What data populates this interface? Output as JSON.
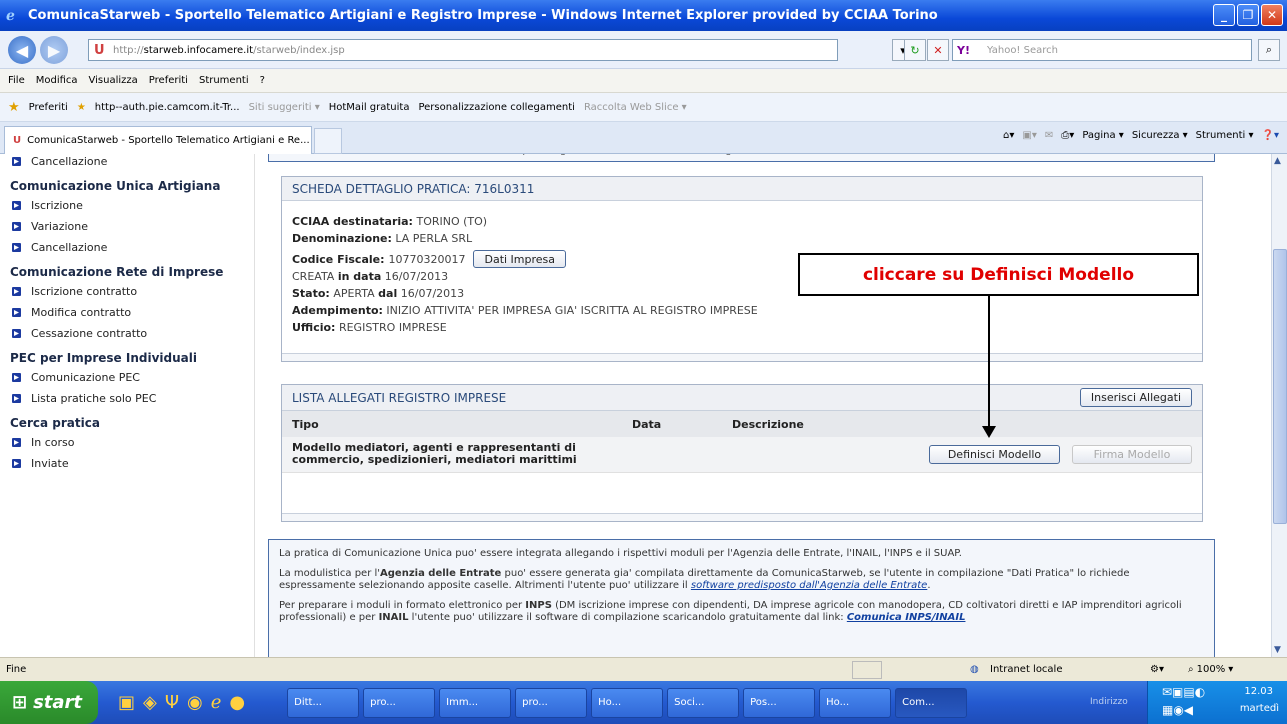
{
  "window": {
    "title": "ComunicaStarweb - Sportello Telematico Artigiani e Registro Imprese - Windows Internet Explorer provided by CCIAA Torino"
  },
  "address": {
    "prefix": "http://",
    "host": "starweb.infocamere.it",
    "path": "/starweb/index.jsp"
  },
  "search": {
    "placeholder": "Yahoo! Search",
    "brand": "Y!"
  },
  "menu": [
    "File",
    "Modifica",
    "Visualizza",
    "Preferiti",
    "Strumenti",
    "?"
  ],
  "favorites": {
    "label": "Preferiti",
    "items": [
      "http--auth.pie.camcom.it-Tr...",
      "Siti suggeriti ▾",
      "HotMail gratuita",
      "Personalizzazione collegamenti",
      "Raccolta Web Slice ▾"
    ]
  },
  "tab": {
    "label": "ComunicaStarweb - Sportello Telematico Artigiani e Re..."
  },
  "toolbar": {
    "pagina": "Pagina ▾",
    "sicurezza": "Sicurezza ▾",
    "strumenti": "Strumenti ▾"
  },
  "sidebar": {
    "top_item": "Cancellazione",
    "sections": [
      {
        "title": "Comunicazione Unica Artigiana",
        "items": [
          "Iscrizione",
          "Variazione",
          "Cancellazione"
        ]
      },
      {
        "title": "Comunicazione Rete di Imprese",
        "items": [
          "Iscrizione contratto",
          "Modifica contratto",
          "Cessazione contratto"
        ]
      },
      {
        "title": "PEC per Imprese Individuali",
        "items": [
          "Comunicazione PEC",
          "Lista pratiche solo PEC"
        ]
      },
      {
        "title": "Cerca pratica",
        "items": [
          "In corso",
          "Inviate"
        ]
      }
    ]
  },
  "top_note": "Per modificare i dati selezionare \"Dati Pratica\", per allegare documenti selezionare \"Allegati RI\"",
  "scheda": {
    "header": "SCHEDA DETTAGLIO PRATICA: 716L0311",
    "cciaa_label": "CCIAA destinataria:",
    "cciaa": "TORINO (TO)",
    "denom_label": "Denominazione:",
    "denom": "LA PERLA SRL",
    "cf_label": "Codice Fiscale:",
    "cf": "10770320017",
    "dati_impresa": "Dati Impresa",
    "creata_pre": "CREATA",
    "creata_label": "in data",
    "creata": "16/07/2013",
    "stato_label": "Stato:",
    "stato": "APERTA",
    "dal_label": "dal",
    "dal": "16/07/2013",
    "adempimento_label": "Adempimento:",
    "adempimento": "INIZIO ATTIVITA' PER IMPRESA GIA' ISCRITTA AL REGISTRO IMPRESE",
    "ufficio_label": "Ufficio:",
    "ufficio": "REGISTRO IMPRESE"
  },
  "callout": "cliccare su Definisci Modello",
  "allegati": {
    "header": "LISTA ALLEGATI REGISTRO IMPRESE",
    "inserisci": "Inserisci Allegati",
    "columns": [
      "Tipo",
      "Data",
      "Descrizione"
    ],
    "row": {
      "tipo": "Modello mediatori, agenti e rappresentanti di commercio, spedizionieri, mediatori marittimi",
      "definisci": "Definisci Modello",
      "firma": "Firma Modello"
    }
  },
  "info": {
    "p1": "La pratica di Comunicazione Unica puo' essere integrata allegando i rispettivi moduli per l'Agenzia delle Entrate, l'INAIL, l'INPS e il SUAP.",
    "p2a": "La modulistica per l'",
    "p2b": "Agenzia delle Entrate",
    "p2c": " puo' essere generata gia' compilata direttamente da ComunicaStarweb, se l'utente in compilazione \"Dati Pratica\" lo richiede espressamente selezionando apposite caselle. Altrimenti l'utente puo' utilizzare il ",
    "p2link": "software predisposto dall'Agenzia delle Entrate",
    "p3a": "Per preparare i moduli in formato elettronico per ",
    "p3b": "INPS",
    "p3c": " (DM iscrizione imprese con dipendenti, DA imprese agricole con manodopera, CD coltivatori diretti e IAP imprenditori agricoli professionali) e per ",
    "p3d": "INAIL",
    "p3e": " l'utente puo' utilizzare il software di compilazione scaricandolo gratuitamente dal link: ",
    "p3link": "Comunica INPS/INAIL"
  },
  "status": {
    "left": "Fine",
    "zone": "Intranet locale",
    "zoom": "100%"
  },
  "taskbar": {
    "start": "start",
    "items": [
      "Ditt...",
      "pro...",
      "Imm...",
      "pro...",
      "Ho...",
      "Soci...",
      "Pos...",
      "Ho...",
      "Com..."
    ],
    "indirizzo": "Indirizzo",
    "time": "12.03",
    "day": "martedì"
  }
}
